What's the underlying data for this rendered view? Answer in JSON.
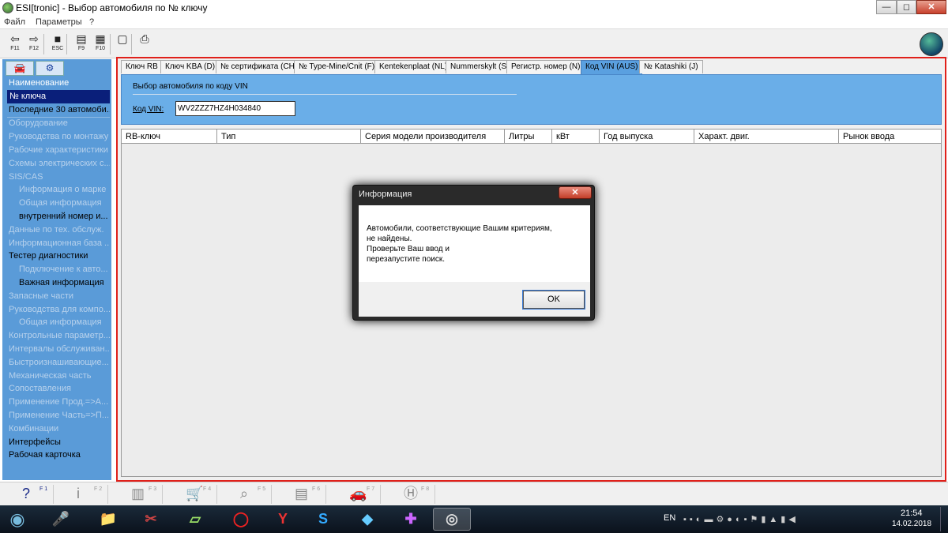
{
  "window": {
    "title": "ESI[tronic] - Выбор автомобиля по № ключу",
    "minimize": "—",
    "restore": "◻",
    "close": "✕"
  },
  "menu": {
    "file": "Файл",
    "params": "Параметры",
    "help": "?"
  },
  "toolbar": {
    "buttons": [
      {
        "glyph": "⇦",
        "key": "F11",
        "icon": "back-arrow-icon"
      },
      {
        "glyph": "⇨",
        "key": "F12",
        "icon": "forward-arrow-icon"
      },
      {
        "glyph": "■",
        "key": "ESC",
        "icon": "esc-stop-icon"
      },
      {
        "glyph": "▤",
        "key": "F9",
        "icon": "list-icon"
      },
      {
        "glyph": "▦",
        "key": "F10",
        "icon": "grid-icon"
      },
      {
        "glyph": "▢",
        "key": "",
        "icon": "document-icon"
      },
      {
        "glyph": "⎙",
        "key": "",
        "icon": "print-icon"
      }
    ]
  },
  "sidebar": {
    "tab_car": "🚘",
    "tab_engine": "⚙",
    "items": [
      {
        "label": "Наименование",
        "style": "w"
      },
      {
        "label": "№ ключа",
        "style": "sel"
      },
      {
        "label": "Последние 30 автомоби...",
        "style": "b"
      },
      {
        "label": "Оборудование",
        "style": "dim"
      },
      {
        "label": "Руководства по монтажу",
        "style": "dim"
      },
      {
        "label": "Рабочие характеристики",
        "style": "dim"
      },
      {
        "label": "Схемы электрических с...",
        "style": "dim"
      },
      {
        "label": "SIS/CAS",
        "style": "dim"
      },
      {
        "label": "Информация о марке",
        "style": "dim sub"
      },
      {
        "label": "Общая информация",
        "style": "dim sub"
      },
      {
        "label": "внутренний номер и...",
        "style": "b sub"
      },
      {
        "label": "Данные по тех. обслуж.",
        "style": "dim"
      },
      {
        "label": "Информационная база ...",
        "style": "dim"
      },
      {
        "label": "Тестер диагностики",
        "style": "b"
      },
      {
        "label": "Подключение к авто...",
        "style": "dim sub"
      },
      {
        "label": "Важная информация",
        "style": "b sub"
      },
      {
        "label": "Запасные части",
        "style": "dim"
      },
      {
        "label": "Руководства для компо...",
        "style": "dim"
      },
      {
        "label": "Общая информация",
        "style": "dim sub"
      },
      {
        "label": "Контрольные параметр...",
        "style": "dim"
      },
      {
        "label": "Интервалы обслуживан...",
        "style": "dim"
      },
      {
        "label": "Быстроизнашивающие...",
        "style": "dim"
      },
      {
        "label": "Механическая часть",
        "style": "dim"
      },
      {
        "label": "Сопоставления",
        "style": "dim"
      },
      {
        "label": "Применение Прод.=>А...",
        "style": "dim"
      },
      {
        "label": "Применение Часть=>П...",
        "style": "dim"
      },
      {
        "label": "Комбинации",
        "style": "dim"
      },
      {
        "label": "Интерфейсы",
        "style": "b"
      },
      {
        "label": "Рабочая карточка",
        "style": "b"
      }
    ]
  },
  "tabs": [
    {
      "label": "Ключ RB",
      "active": false
    },
    {
      "label": "Ключ KBA (D)",
      "active": false
    },
    {
      "label": "№ сертификата (CH)",
      "active": false
    },
    {
      "label": "№ Type-Mine/Cnit (F)",
      "active": false
    },
    {
      "label": "Kentekenplaat (NL)",
      "active": false
    },
    {
      "label": "Nummerskylt (S)",
      "active": false
    },
    {
      "label": "Регистр. номер (N)",
      "active": false
    },
    {
      "label": "Код VIN (AUS)",
      "active": true
    },
    {
      "label": "№ Katashiki (J)",
      "active": false
    }
  ],
  "vin_panel": {
    "caption": "Выбор автомобиля по коду VIN",
    "label": "Код VIN:",
    "value": "WV2ZZZ7HZ4H034840"
  },
  "grid": {
    "columns": [
      "RB-ключ",
      "Тип",
      "Серия модели производителя",
      "Литры",
      "кВт",
      "Год выпуска",
      "Характ. двиг.",
      "Рынок ввода"
    ]
  },
  "dialog": {
    "title": "Информация",
    "close": "✕",
    "lines": [
      "Автомобили, соответствующие Вашим критериям,",
      "не найдены.",
      "Проверьте Ваш ввод и",
      "перезапустите поиск."
    ],
    "ok": "OK"
  },
  "fkeys": [
    {
      "glyph": "?",
      "num": "F 1",
      "icon": "help-icon",
      "on": true
    },
    {
      "glyph": "i",
      "num": "F 2",
      "icon": "info-icon",
      "on": false
    },
    {
      "glyph": "▥",
      "num": "F 3",
      "icon": "document-list-icon",
      "on": false
    },
    {
      "glyph": "🛒",
      "num": "F 4",
      "icon": "cart-icon",
      "on": false
    },
    {
      "glyph": "⌕",
      "num": "F 5",
      "icon": "zoom-icon",
      "on": false
    },
    {
      "glyph": "▤",
      "num": "F 6",
      "icon": "calculator-icon",
      "on": false
    },
    {
      "glyph": "🚗",
      "num": "F 7",
      "icon": "car-icon",
      "on": false
    },
    {
      "glyph": "Ⓗ",
      "num": "F 8",
      "icon": "h-circle-icon",
      "on": false
    }
  ],
  "taskbar": {
    "start": "◉",
    "apps": [
      {
        "glyph": "🎤",
        "icon": "voice-assistant-icon"
      },
      {
        "glyph": "📁",
        "icon": "folder-icon"
      },
      {
        "glyph": "✂",
        "icon": "snipping-icon"
      },
      {
        "glyph": "▱",
        "icon": "notes-icon"
      },
      {
        "glyph": "◯",
        "icon": "opera-icon"
      },
      {
        "glyph": "Y",
        "icon": "yandex-icon"
      },
      {
        "glyph": "S",
        "icon": "skype-icon"
      },
      {
        "glyph": "◆",
        "icon": "app-blue-icon"
      },
      {
        "glyph": "✚",
        "icon": "app-purple-icon"
      },
      {
        "glyph": "◎",
        "icon": "esitronic-disc-icon"
      }
    ],
    "lang": "EN",
    "time": "21:54",
    "date": "14.02.2018"
  }
}
